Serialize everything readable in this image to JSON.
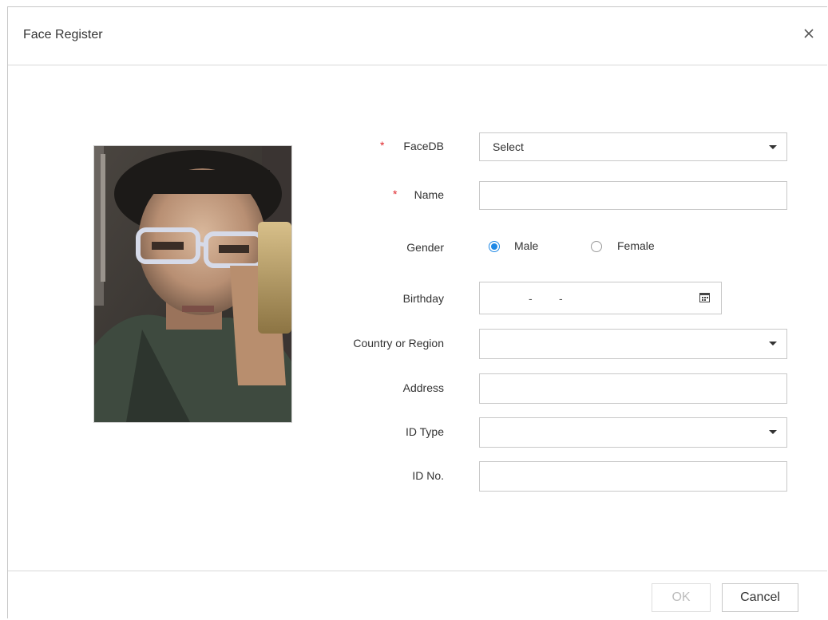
{
  "dialog": {
    "title": "Face Register",
    "close_icon": "close-icon"
  },
  "form": {
    "facedb": {
      "label": "FaceDB",
      "required_mark": "*",
      "value": "Select"
    },
    "name": {
      "label": "Name",
      "required_mark": "*",
      "value": ""
    },
    "gender": {
      "label": "Gender",
      "options": [
        "Male",
        "Female"
      ],
      "selected": "Male"
    },
    "birthday": {
      "label": "Birthday",
      "sep1": "-",
      "sep2": "-",
      "icon": "calendar-icon"
    },
    "country": {
      "label": "Country or Region",
      "value": ""
    },
    "address": {
      "label": "Address",
      "value": ""
    },
    "id_type": {
      "label": "ID Type",
      "value": ""
    },
    "id_no": {
      "label": "ID No.",
      "value": ""
    }
  },
  "footer": {
    "ok_label": "OK",
    "cancel_label": "Cancel"
  },
  "colors": {
    "accent": "#1e88e5",
    "required": "#e0292e",
    "disabled_text": "#bdbdbd"
  }
}
